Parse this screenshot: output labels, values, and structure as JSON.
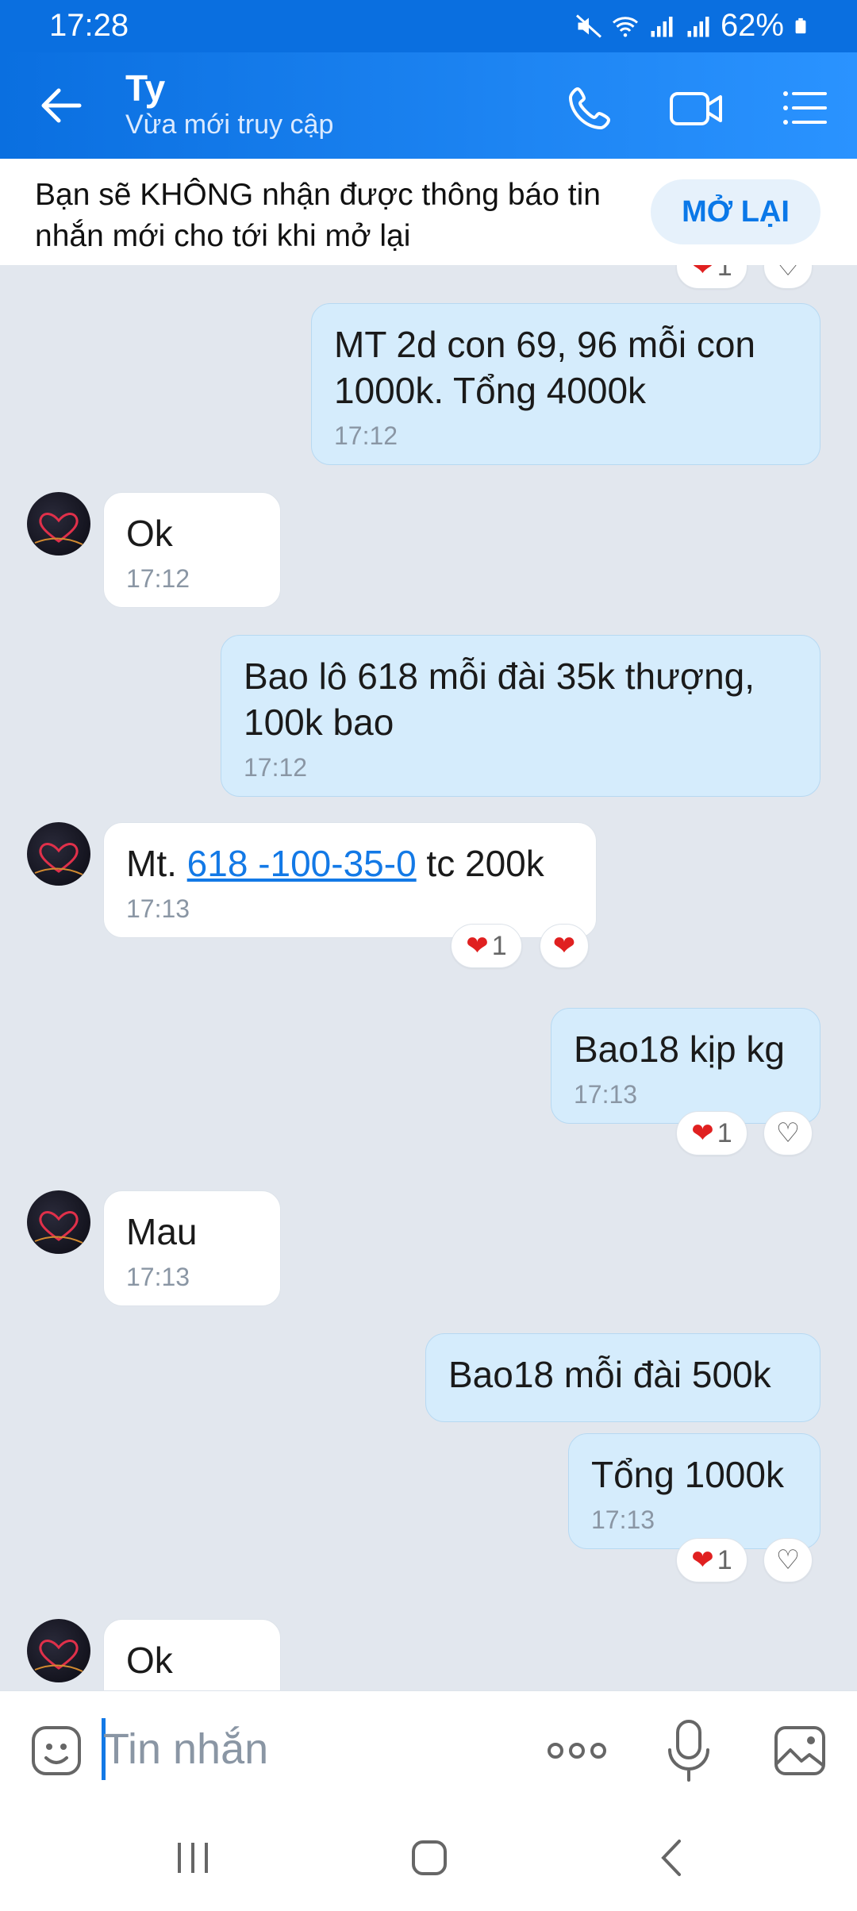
{
  "status": {
    "time": "17:28",
    "battery": "62%"
  },
  "header": {
    "title": "Ty",
    "subtitle": "Vừa mới truy cập"
  },
  "notice": {
    "text": "Bạn sẽ KHÔNG nhận được thông báo tin nhắn mới cho tới khi mở lại",
    "button": "MỞ LẠI"
  },
  "messages": [
    {
      "dir": "out",
      "text": "MT 2d con 69, 96 mỗi con 1000k. Tổng 4000k",
      "time": "17:12"
    },
    {
      "dir": "in",
      "text": "Ok",
      "time": "17:12"
    },
    {
      "dir": "out",
      "text": "Bao lô 618 mỗi đài 35k thượng, 100k bao",
      "time": "17:12"
    },
    {
      "dir": "in",
      "text_prefix": "Mt. ",
      "link": "618 -100-35-0",
      "text_suffix": " tc 200k",
      "time": "17:13",
      "reaction_count": "1"
    },
    {
      "dir": "out",
      "text": "Bao18 kịp kg",
      "time": "17:13",
      "reaction_count": "1"
    },
    {
      "dir": "in",
      "text": "Mau",
      "time": "17:13"
    },
    {
      "dir": "out",
      "text": "Bao18 mỗi đài 500k"
    },
    {
      "dir": "out",
      "text": "Tổng 1000k",
      "time": "17:13",
      "reaction_count": "1"
    },
    {
      "dir": "in",
      "text": "Ok"
    }
  ],
  "top_reaction_count": "1",
  "input": {
    "placeholder": "Tin nhắn"
  },
  "colors": {
    "header": "#0a6fe0",
    "bubble_out": "#d5ecfc",
    "bubble_in": "#ffffff",
    "link": "#1379e6",
    "background": "#e2e7ee"
  }
}
